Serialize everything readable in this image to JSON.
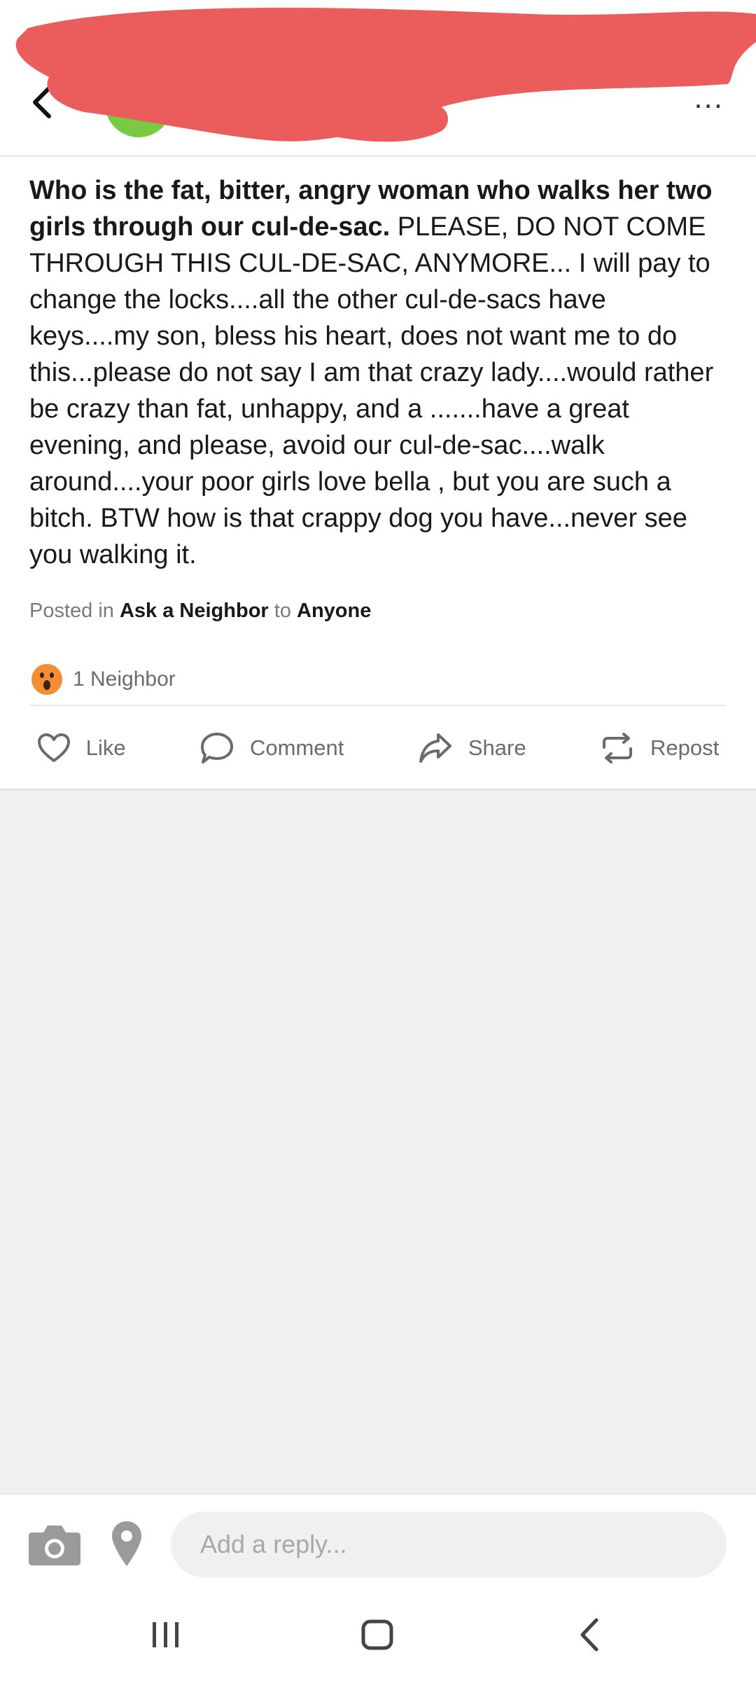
{
  "header": {
    "back_icon": "arrow-left-icon",
    "more_icon": "ellipsis-icon",
    "more_label": "..."
  },
  "post": {
    "title": "Who is the fat, bitter, angry woman who walks her two girls through our cul-de-sac.",
    "body": " PLEASE, DO NOT COME THROUGH THIS CUL-DE-SAC, ANYMORE...  I will pay to change the locks....all the other cul-de-sacs have keys....my son, bless his heart, does not want me to do this...please do not say I am that crazy lady....would rather be crazy than fat, unhappy, and a .......have a great evening, and please, avoid our cul-de-sac....walk around....your poor girls love bella , but you are such a bitch.  BTW how is that crappy dog you have...never see you walking it.",
    "meta": {
      "posted_in_prefix": "Posted in ",
      "category": "Ask a Neighbor",
      "to_prefix": " to ",
      "audience": "Anyone"
    },
    "reactions": {
      "emoji_icon": "wow-face-icon",
      "label": "1 Neighbor"
    },
    "actions": {
      "like": "Like",
      "comment": "Comment",
      "share": "Share",
      "repost": "Repost"
    }
  },
  "reply": {
    "placeholder": "Add a reply...",
    "camera_icon": "camera-icon",
    "location_icon": "location-pin-icon"
  },
  "system_nav": {
    "recent_icon": "recent-apps-icon",
    "home_icon": "home-icon",
    "back_icon": "back-icon"
  },
  "colors": {
    "redaction": "#eb5c5c",
    "avatar": "#7ac943",
    "text": "#191919",
    "muted": "#7a7a7a",
    "background": "#f0f0f0"
  }
}
